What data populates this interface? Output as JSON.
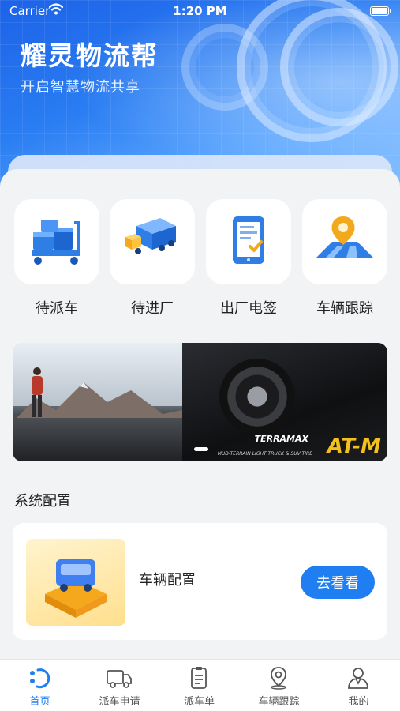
{
  "status_bar": {
    "carrier": "Carrier",
    "time": "1:20 PM"
  },
  "header": {
    "title": "耀灵物流帮",
    "subtitle": "开启智慧物流共享"
  },
  "quick_actions": [
    {
      "label": "待派车",
      "icon": "cart-boxes-icon"
    },
    {
      "label": "待进厂",
      "icon": "trucks-icon"
    },
    {
      "label": "出厂电签",
      "icon": "phone-sign-icon"
    },
    {
      "label": "车辆跟踪",
      "icon": "map-pin-icon"
    }
  ],
  "banner": {
    "brand": "TERRAMAX",
    "tagline": "MUD-TERRAIN LIGHT TRUCK & SUV TIRE",
    "product": "AT-M",
    "slides_count": 1,
    "active_slide": 1
  },
  "section": {
    "title": "系统配置"
  },
  "config_card": {
    "label": "车辆配置",
    "button": "去看看",
    "icon": "truck-config-icon"
  },
  "tabbar": {
    "active": "首页",
    "items": [
      {
        "label": "首页",
        "icon": "home-icon"
      },
      {
        "label": "派车申请",
        "icon": "truck-icon"
      },
      {
        "label": "派车单",
        "icon": "clipboard-icon"
      },
      {
        "label": "车辆跟踪",
        "icon": "location-icon"
      },
      {
        "label": "我的",
        "icon": "user-icon"
      }
    ]
  },
  "colors": {
    "accent": "#1f7ef2",
    "header": "#2a7df2",
    "background": "#f2f3f5"
  }
}
